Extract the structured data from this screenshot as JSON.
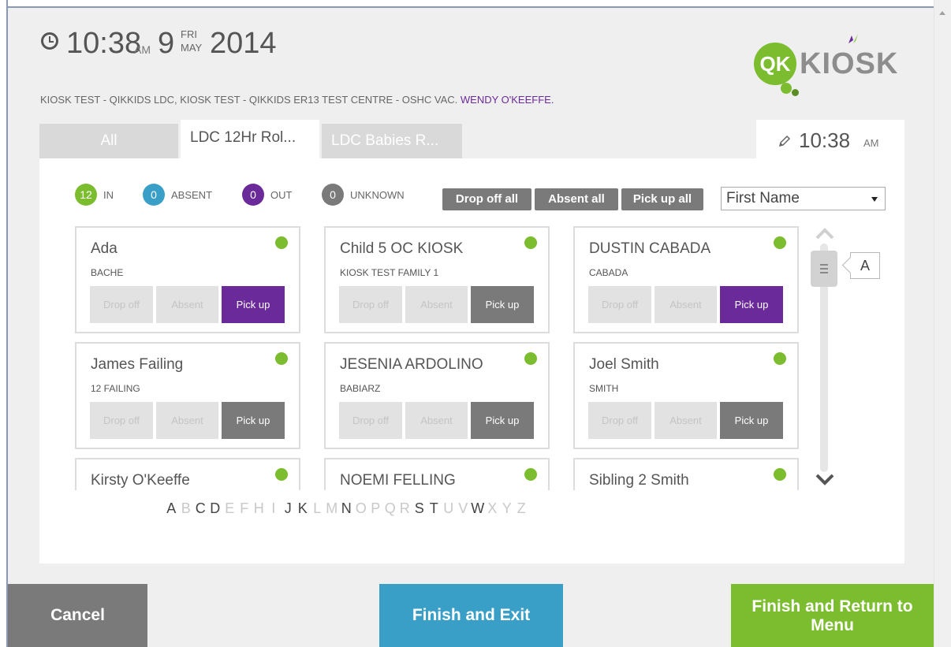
{
  "header": {
    "time": "10:38",
    "ampm": "AM",
    "day": "9",
    "weekday": "FRI",
    "month": "MAY",
    "year": "2014",
    "location": "KIOSK TEST - QIKKIDS LDC, KIOSK TEST - QIKKIDS ER13 TEST CENTRE - OSHC VAC. ",
    "user": "WENDY O'KEEFFE."
  },
  "logo": {
    "badge": "QK",
    "word": "KIOSK"
  },
  "tabs": [
    {
      "label": "All"
    },
    {
      "label": "LDC 12Hr Rol..."
    },
    {
      "label": "LDC Babies R..."
    }
  ],
  "tab_time": {
    "time": "10:38",
    "ampm": "AM"
  },
  "status": {
    "in": {
      "count": "12",
      "label": "IN"
    },
    "absent": {
      "count": "0",
      "label": "ABSENT"
    },
    "out": {
      "count": "0",
      "label": "OUT"
    },
    "unknown": {
      "count": "0",
      "label": "UNKNOWN"
    }
  },
  "bulk": {
    "drop_off": "Drop off all",
    "absent": "Absent all",
    "pick_up": "Pick up all"
  },
  "sort": {
    "selected": "First Name"
  },
  "button_labels": {
    "drop_off": "Drop off",
    "absent": "Absent",
    "pick_up": "Pick up"
  },
  "children": [
    {
      "name": "Ada",
      "family": "BACHE"
    },
    {
      "name": "Child 5 OC KIOSK",
      "family": "KIOSK TEST FAMILY 1"
    },
    {
      "name": "DUSTIN CABADA",
      "family": "CABADA"
    },
    {
      "name": "James Failing",
      "family": "12 FAILING"
    },
    {
      "name": "JESENIA ARDOLINO",
      "family": "BABIARZ"
    },
    {
      "name": "Joel Smith",
      "family": "SMITH"
    },
    {
      "name": "Kirsty O'Keeffe",
      "family": ""
    },
    {
      "name": "NOEMI FELLING",
      "family": ""
    },
    {
      "name": "Sibling 2 Smith",
      "family": ""
    }
  ],
  "scroll": {
    "letter": "A"
  },
  "alphabet": [
    {
      "l": "A",
      "on": true
    },
    {
      "l": "B",
      "on": false
    },
    {
      "l": "C",
      "on": true
    },
    {
      "l": "D",
      "on": true
    },
    {
      "l": "E",
      "on": false
    },
    {
      "l": "F",
      "on": false
    },
    {
      "l": "H",
      "on": false
    },
    {
      "l": "I",
      "on": false
    },
    {
      "l": "J",
      "on": true
    },
    {
      "l": "K",
      "on": true
    },
    {
      "l": "L",
      "on": false
    },
    {
      "l": "M",
      "on": false
    },
    {
      "l": "N",
      "on": true
    },
    {
      "l": "O",
      "on": false
    },
    {
      "l": "P",
      "on": false
    },
    {
      "l": "Q",
      "on": false
    },
    {
      "l": "R",
      "on": false
    },
    {
      "l": "S",
      "on": true
    },
    {
      "l": "T",
      "on": true
    },
    {
      "l": "U",
      "on": false
    },
    {
      "l": "V",
      "on": false
    },
    {
      "l": "W",
      "on": true
    },
    {
      "l": "X",
      "on": false
    },
    {
      "l": "Y",
      "on": false
    },
    {
      "l": "Z",
      "on": false
    }
  ],
  "footer": {
    "cancel": "Cancel",
    "finish_exit": "Finish and Exit",
    "finish_menu": "Finish and Return to Menu"
  },
  "colors": {
    "green": "#7bbd2e",
    "blue": "#3a9fc7",
    "purple": "#6b2a9a",
    "gray": "#7a7a7a"
  }
}
